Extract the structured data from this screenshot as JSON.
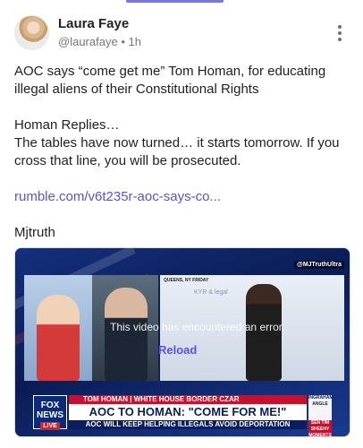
{
  "post": {
    "author_name": "Laura Faye",
    "author_handle": "@laurafaye",
    "time_ago": "1h",
    "text_lines": {
      "p1": "AOC says “come get me” Tom Homan, for educating illegal aliens of their Constitutional Rights",
      "p2a": "Homan Replies…",
      "p2b": "The tables have now turned… it starts tomorrow. If you cross that line, you will be prosecuted.",
      "link": "rumble.com/v6t235r-aoc-says-co...",
      "sign": "Mjtruth"
    }
  },
  "video": {
    "error_message": "This video has encountered an error.",
    "reload_label": "Reload",
    "watermark": "@MJTruthUltra",
    "slide_location": "QUEENS, NY FRIDAY",
    "slide_bullet": "KYR & legal",
    "lower_third": {
      "logo": "FOX NEWS",
      "live": "LIVE",
      "top": "TOM HOMAN | WHITE HOUSE BORDER CZAR",
      "main": "AOC TO HOMAN: \"COME FOR ME!\"",
      "sub": "AOC WILL KEEP HELPING ILLEGALS AVOID DEPORTATION",
      "angle_show": "INGRAHAM ANGLE",
      "angle_tag": "SEN TIM SHEEHY MOMENTS AWAY"
    }
  },
  "colors": {
    "accent": "#5a52d6",
    "indicator": "#7b73e8",
    "fox_red": "#c8102e",
    "fox_blue": "#0b1d5a"
  },
  "icons": {
    "more": "kebab-vertical-icon"
  }
}
